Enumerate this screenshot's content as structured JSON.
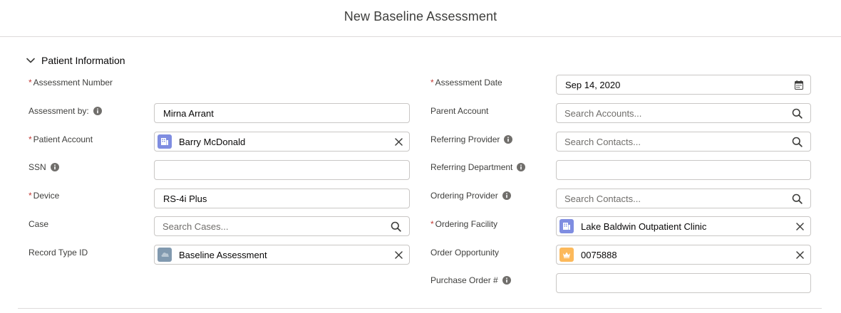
{
  "modal": {
    "title": "New Baseline Assessment"
  },
  "section": {
    "title": "Patient Information"
  },
  "left": {
    "assessment_number": {
      "label": "Assessment Number"
    },
    "assessment_by": {
      "label": "Assessment by:",
      "value": "Mirna Arrant"
    },
    "patient_account": {
      "label": "Patient Account",
      "value": "Barry McDonald"
    },
    "ssn": {
      "label": "SSN",
      "value": ""
    },
    "device": {
      "label": "Device",
      "value": "RS-4i Plus"
    },
    "case": {
      "label": "Case",
      "placeholder": "Search Cases..."
    },
    "record_type": {
      "label": "Record Type ID",
      "value": "Baseline Assessment"
    }
  },
  "right": {
    "assessment_date": {
      "label": "Assessment Date",
      "value": "Sep 14, 2020"
    },
    "parent_account": {
      "label": "Parent Account",
      "placeholder": "Search Accounts..."
    },
    "referring_provider": {
      "label": "Referring Provider",
      "placeholder": "Search Contacts..."
    },
    "referring_department": {
      "label": "Referring Department",
      "value": ""
    },
    "ordering_provider": {
      "label": "Ordering Provider",
      "placeholder": "Search Contacts..."
    },
    "ordering_facility": {
      "label": "Ordering Facility",
      "value": "Lake Baldwin Outpatient Clinic"
    },
    "order_opportunity": {
      "label": "Order Opportunity",
      "value": "0075888"
    },
    "purchase_order": {
      "label": "Purchase Order #",
      "value": ""
    }
  },
  "required_marker": "*",
  "icons": {
    "account": "building-icon",
    "record_type": "record-type-icon",
    "opportunity": "crown-icon",
    "search": "search-icon",
    "clear": "close-icon",
    "calendar": "calendar-icon",
    "info": "info-icon",
    "chevron": "chevron-down-icon"
  },
  "colors": {
    "account_icon": "#7f8de1",
    "record_type_icon": "#8199af",
    "opportunity_icon": "#fcb95b",
    "required": "#c23934"
  }
}
